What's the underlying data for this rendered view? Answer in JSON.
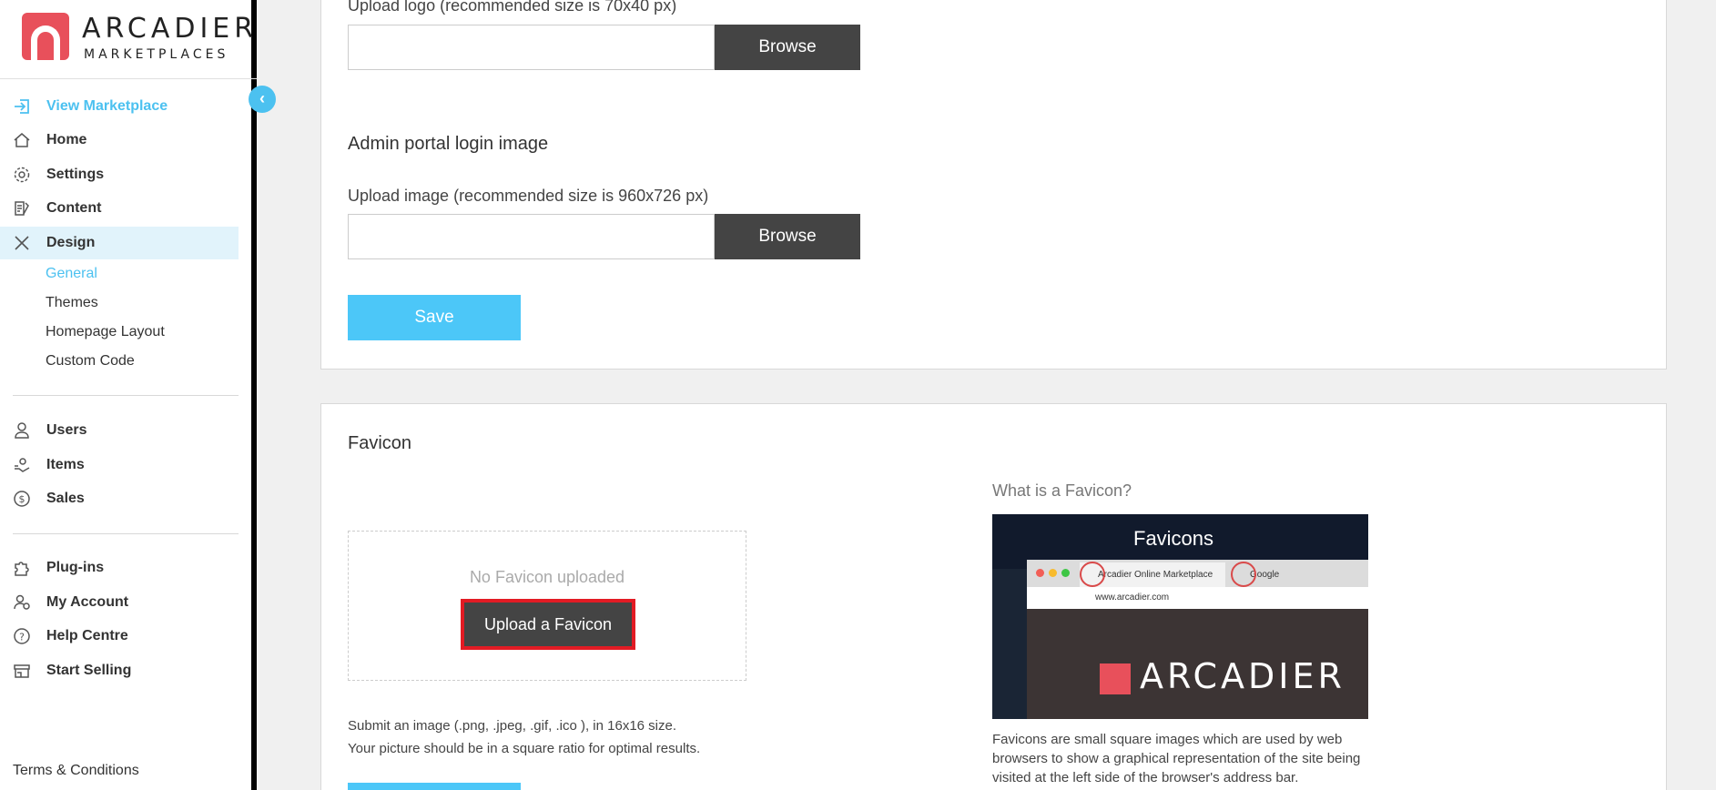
{
  "brand": {
    "name": "ARCADIER",
    "tagline": "MARKETPLACES"
  },
  "sidebar": {
    "items": [
      {
        "label": "View Marketplace",
        "icon": "enter-icon"
      },
      {
        "label": "Home",
        "icon": "home-icon"
      },
      {
        "label": "Settings",
        "icon": "gear-icon"
      },
      {
        "label": "Content",
        "icon": "content-icon"
      },
      {
        "label": "Design",
        "icon": "design-icon"
      }
    ],
    "design_sub": [
      "General",
      "Themes",
      "Homepage Layout",
      "Custom Code"
    ],
    "items2": [
      {
        "label": "Users",
        "icon": "user-icon"
      },
      {
        "label": "Items",
        "icon": "items-icon"
      },
      {
        "label": "Sales",
        "icon": "dollar-icon"
      }
    ],
    "items3": [
      {
        "label": "Plug-ins",
        "icon": "puzzle-icon"
      },
      {
        "label": "My Account",
        "icon": "account-icon"
      },
      {
        "label": "Help Centre",
        "icon": "help-icon"
      },
      {
        "label": "Start Selling",
        "icon": "store-icon"
      }
    ],
    "terms": "Terms & Conditions"
  },
  "logo_section": {
    "upload_label": "Upload logo (recommended size is 70x40 px)",
    "browse": "Browse"
  },
  "login_image": {
    "title": "Admin portal login image",
    "upload_label": "Upload image (recommended size is 960x726 px)",
    "browse": "Browse",
    "save": "Save"
  },
  "favicon": {
    "title": "Favicon",
    "empty_text": "No Favicon uploaded",
    "upload_button": "Upload a Favicon",
    "help_line1": "Submit an image (.png, .jpeg, .gif, .ico ), in 16x16 size.",
    "help_line2": "Your picture should be in a square ratio for optimal results.",
    "what_is": "What is a Favicon?",
    "image": {
      "heading": "Favicons",
      "tab1": "Arcadier Online Marketplace",
      "tab2": "Google",
      "url": "www.arcadier.com",
      "brand": "ARCADIER"
    },
    "description": "Favicons are small square images which are used by web browsers to show a graphical representation of the site being visited at the left side of the browser's address bar."
  },
  "colors": {
    "accent": "#4cc1f0",
    "dark_button": "#444444",
    "highlight": "#e21b24",
    "brand_red": "#e8505b"
  }
}
